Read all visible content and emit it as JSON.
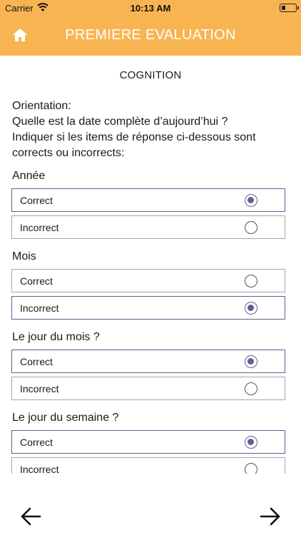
{
  "status_bar": {
    "carrier": "Carrier",
    "time": "10:13 AM"
  },
  "header": {
    "title": "PREMIERE EVALUATION",
    "home_icon": "home-icon"
  },
  "section": {
    "title": "COGNITION",
    "instructions": [
      "Orientation:",
      "Quelle est la date complète d’aujourd’hui ?",
      "Indiquer si les items de réponse ci-dessous sont",
      "corrects ou incorrects:"
    ]
  },
  "questions": [
    {
      "label": "Année",
      "options": [
        {
          "label": "Correct",
          "selected": true
        },
        {
          "label": "Incorrect",
          "selected": false
        }
      ]
    },
    {
      "label": "Mois",
      "options": [
        {
          "label": "Correct",
          "selected": false
        },
        {
          "label": "Incorrect",
          "selected": true
        }
      ]
    },
    {
      "label": "Le jour du mois ?",
      "options": [
        {
          "label": "Correct",
          "selected": true
        },
        {
          "label": "Incorrect",
          "selected": false
        }
      ]
    },
    {
      "label": "Le jour du semaine ?",
      "options": [
        {
          "label": "Correct",
          "selected": true
        },
        {
          "label": "Incorrect",
          "selected": false
        }
      ]
    }
  ],
  "navigation": {
    "back_icon": "arrow-left-icon",
    "next_icon": "arrow-right-icon"
  },
  "colors": {
    "header": "#f9b452",
    "accent": "#6c5a93",
    "border": "#a7a7a7"
  }
}
